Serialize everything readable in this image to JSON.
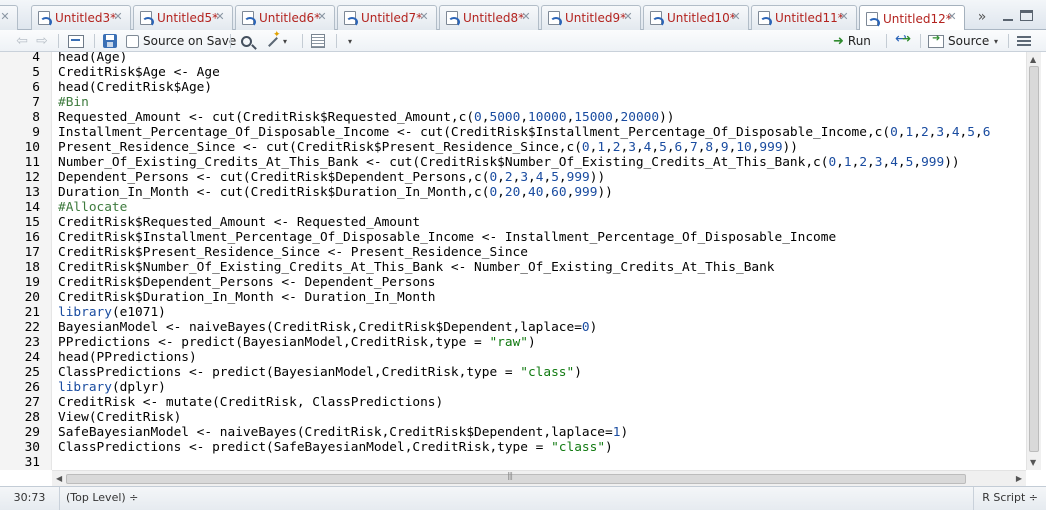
{
  "tabs": [
    {
      "label": "*",
      "close": "✕"
    },
    {
      "label": "Untitled3*",
      "close": "✕"
    },
    {
      "label": "Untitled5*",
      "close": "✕"
    },
    {
      "label": "Untitled6*",
      "close": "✕"
    },
    {
      "label": "Untitled7*",
      "close": "✕"
    },
    {
      "label": "Untitled8*",
      "close": "✕"
    },
    {
      "label": "Untitled9*",
      "close": "✕"
    },
    {
      "label": "Untitled10*",
      "close": "✕"
    },
    {
      "label": "Untitled11*",
      "close": "✕"
    },
    {
      "label": "Untitled12*",
      "close": "✕"
    }
  ],
  "active_tab": "Untitled12*",
  "tab_more": "»",
  "toolbar": {
    "back": "⇦",
    "forward": "⇨",
    "source_on_save": "Source on Save",
    "run": "Run",
    "source": "Source",
    "dropdown_caret": "▾"
  },
  "code_lines": [
    {
      "n": "4",
      "t": "head(Age)"
    },
    {
      "n": "5",
      "t": "CreditRisk$Age <- Age"
    },
    {
      "n": "6",
      "t": "head(CreditRisk$Age)"
    },
    {
      "n": "7",
      "t": "#Bin"
    },
    {
      "n": "8",
      "t": "Requested_Amount <- cut(CreditRisk$Requested_Amount,c(0,5000,10000,15000,20000))"
    },
    {
      "n": "9",
      "t": "Installment_Percentage_Of_Disposable_Income <- cut(CreditRisk$Installment_Percentage_Of_Disposable_Income,c(0,1,2,3,4,5,6"
    },
    {
      "n": "10",
      "t": "Present_Residence_Since <- cut(CreditRisk$Present_Residence_Since,c(0,1,2,3,4,5,6,7,8,9,10,999))"
    },
    {
      "n": "11",
      "t": "Number_Of_Existing_Credits_At_This_Bank <- cut(CreditRisk$Number_Of_Existing_Credits_At_This_Bank,c(0,1,2,3,4,5,999))"
    },
    {
      "n": "12",
      "t": "Dependent_Persons <- cut(CreditRisk$Dependent_Persons,c(0,2,3,4,5,999))"
    },
    {
      "n": "13",
      "t": "Duration_In_Month <- cut(CreditRisk$Duration_In_Month,c(0,20,40,60,999))"
    },
    {
      "n": "14",
      "t": "#Allocate"
    },
    {
      "n": "15",
      "t": "CreditRisk$Requested_Amount <- Requested_Amount"
    },
    {
      "n": "16",
      "t": "CreditRisk$Installment_Percentage_Of_Disposable_Income <- Installment_Percentage_Of_Disposable_Income"
    },
    {
      "n": "17",
      "t": "CreditRisk$Present_Residence_Since <- Present_Residence_Since"
    },
    {
      "n": "18",
      "t": "CreditRisk$Number_Of_Existing_Credits_At_This_Bank <- Number_Of_Existing_Credits_At_This_Bank"
    },
    {
      "n": "19",
      "t": "CreditRisk$Dependent_Persons <- Dependent_Persons"
    },
    {
      "n": "20",
      "t": "CreditRisk$Duration_In_Month <- Duration_In_Month"
    },
    {
      "n": "21",
      "t": "library(e1071)"
    },
    {
      "n": "22",
      "t": "BayesianModel <- naiveBayes(CreditRisk,CreditRisk$Dependent,laplace=0)"
    },
    {
      "n": "23",
      "t": "PPredictions <- predict(BayesianModel,CreditRisk,type = \"raw\")"
    },
    {
      "n": "24",
      "t": "head(PPredictions)"
    },
    {
      "n": "25",
      "t": "ClassPredictions <- predict(BayesianModel,CreditRisk,type = \"class\")"
    },
    {
      "n": "26",
      "t": "library(dplyr)"
    },
    {
      "n": "27",
      "t": "CreditRisk <- mutate(CreditRisk, ClassPredictions)"
    },
    {
      "n": "28",
      "t": "View(CreditRisk)"
    },
    {
      "n": "29",
      "t": "SafeBayesianModel <- naiveBayes(CreditRisk,CreditRisk$Dependent,laplace=1)"
    },
    {
      "n": "30",
      "t": "ClassPredictions <- predict(SafeBayesianModel,CreditRisk,type = \"class\")"
    },
    {
      "n": "31",
      "t": ""
    }
  ],
  "status": {
    "position": "30:73",
    "scope": "(Top Level) ÷",
    "filetype": "R Script ÷"
  },
  "colors": {
    "tab_text": "#b3231f",
    "keyword": "#1a4ca0",
    "string": "#117a11",
    "comment": "#3d7a3d"
  }
}
